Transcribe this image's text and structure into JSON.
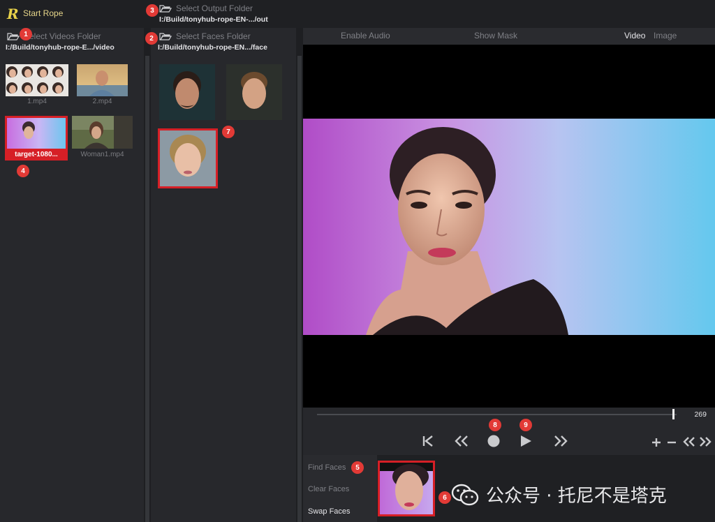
{
  "app": {
    "logo": "R",
    "start_label": "Start Rope"
  },
  "output_folder": {
    "label": "Select Output Folder",
    "path": "I:/Build/tonyhub-rope-EN-.../out"
  },
  "videos_panel": {
    "label": "Select Videos Folder",
    "path": "I:/Build/tonyhub-rope-E.../video",
    "items": [
      {
        "name": "1.mp4"
      },
      {
        "name": "2.mp4"
      },
      {
        "name": "target-1080..."
      },
      {
        "name": "Woman1.mp4"
      }
    ]
  },
  "faces_panel": {
    "label": "Select Faces Folder",
    "path": "I:/Build/tonyhub-rope-EN.../face"
  },
  "preview": {
    "tabs": {
      "audio": "Enable Audio",
      "mask": "Show Mask",
      "video": "Video",
      "image": "Image"
    },
    "frame_number": "269",
    "progress": 0.99
  },
  "actions": {
    "find": "Find Faces",
    "clear": "Clear Faces",
    "swap": "Swap Faces"
  },
  "markers": [
    "1",
    "2",
    "3",
    "4",
    "5",
    "6",
    "7",
    "8",
    "9"
  ],
  "watermark": {
    "text": "公众号 · 托尼不是塔克",
    "icon": "wechat-icon"
  },
  "colors": {
    "accent_red": "#d61f26",
    "logo_yellow": "#e8d24a"
  }
}
